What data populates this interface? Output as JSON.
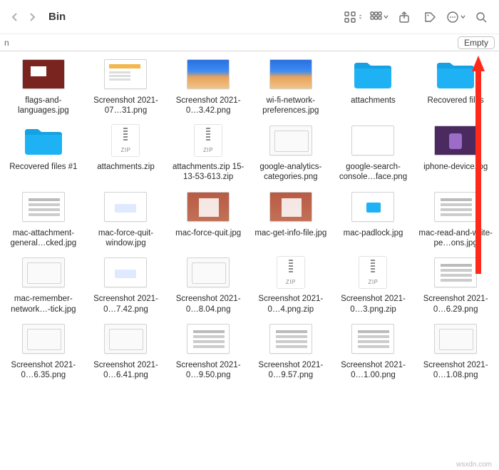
{
  "header": {
    "title": "Bin",
    "pathbar_fragment": "n",
    "empty_label": "Empty"
  },
  "items": [
    {
      "name": "flags-and-languages.jpg",
      "kind": "image",
      "variant": "photo1"
    },
    {
      "name": "Screenshot 2021-07…31.png",
      "kind": "image",
      "variant": "doc"
    },
    {
      "name": "Screenshot 2021-0…3.42.png",
      "kind": "image",
      "variant": "scenic"
    },
    {
      "name": "wi-fi-network-preferences.jpg",
      "kind": "image",
      "variant": "scenic"
    },
    {
      "name": "attachments",
      "kind": "folder"
    },
    {
      "name": "Recovered files",
      "kind": "folder"
    },
    {
      "name": "Recovered files #1",
      "kind": "folder"
    },
    {
      "name": "attachments.zip",
      "kind": "zip"
    },
    {
      "name": "attachments.zip 15-13-53-613.zip",
      "kind": "zip"
    },
    {
      "name": "google-analytics-categories.png",
      "kind": "image",
      "variant": "app"
    },
    {
      "name": "google-search-console…face.png",
      "kind": "image",
      "variant": "app-colored"
    },
    {
      "name": "iphone-device.jpg",
      "kind": "image",
      "variant": "dark"
    },
    {
      "name": "mac-attachment-general…cked.jpg",
      "kind": "image",
      "variant": "textonly"
    },
    {
      "name": "mac-force-quit-window.jpg",
      "kind": "image",
      "variant": "app-dialog"
    },
    {
      "name": "mac-force-quit.jpg",
      "kind": "image",
      "variant": "brick"
    },
    {
      "name": "mac-get-info-file.jpg",
      "kind": "image",
      "variant": "brick"
    },
    {
      "name": "mac-padlock.jpg",
      "kind": "image",
      "variant": "folder-mini"
    },
    {
      "name": "mac-read-and-write-pe…ons.jpg",
      "kind": "image",
      "variant": "textonly"
    },
    {
      "name": "mac-remember-network…-tick.jpg",
      "kind": "image",
      "variant": "app"
    },
    {
      "name": "Screenshot 2021-0…7.42.png",
      "kind": "image",
      "variant": "app-dialog"
    },
    {
      "name": "Screenshot 2021-0…8.04.png",
      "kind": "image",
      "variant": "app"
    },
    {
      "name": "Screenshot 2021-0…4.png.zip",
      "kind": "zip"
    },
    {
      "name": "Screenshot 2021-0…3.png.zip",
      "kind": "zip"
    },
    {
      "name": "Screenshot 2021-0…6.29.png",
      "kind": "image",
      "variant": "textonly"
    },
    {
      "name": "Screenshot 2021-0…6.35.png",
      "kind": "image",
      "variant": "app"
    },
    {
      "name": "Screenshot 2021-0…6.41.png",
      "kind": "image",
      "variant": "app"
    },
    {
      "name": "Screenshot 2021-0…9.50.png",
      "kind": "image",
      "variant": "textonly"
    },
    {
      "name": "Screenshot 2021-0…9.57.png",
      "kind": "image",
      "variant": "textonly"
    },
    {
      "name": "Screenshot 2021-0…1.00.png",
      "kind": "image",
      "variant": "textonly"
    },
    {
      "name": "Screenshot 2021-0…1.08.png",
      "kind": "image",
      "variant": "app"
    }
  ],
  "footer": {
    "watermark": "wsxdn.com"
  }
}
